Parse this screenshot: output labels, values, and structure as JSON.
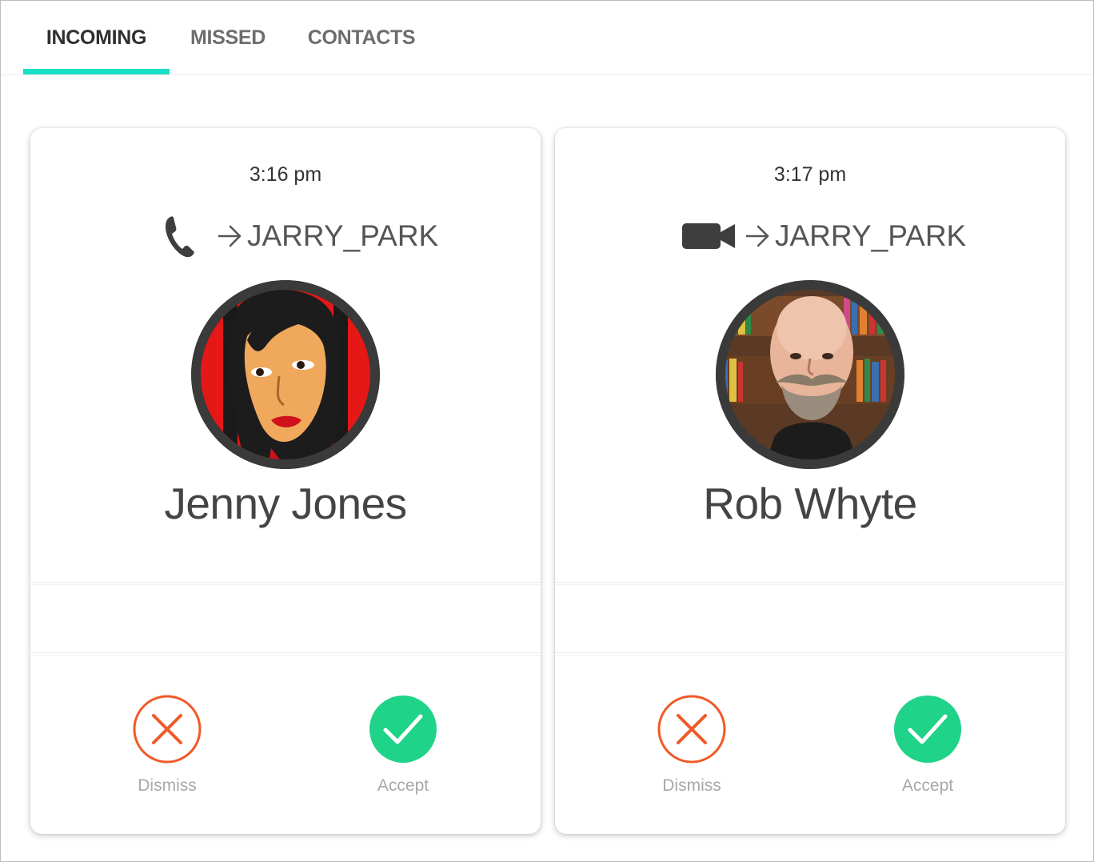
{
  "tabs": [
    {
      "label": "INCOMING",
      "active": true
    },
    {
      "label": "MISSED",
      "active": false
    },
    {
      "label": "CONTACTS",
      "active": false
    }
  ],
  "accent_color": "#19dfc4",
  "calls": [
    {
      "time": "3:16 pm",
      "call_type_icon": "phone-icon",
      "destination": "JARRY_PARK",
      "caller_name": "Jenny Jones",
      "dismiss_label": "Dismiss",
      "accept_label": "Accept"
    },
    {
      "time": "3:17 pm",
      "call_type_icon": "video-camera-icon",
      "destination": "JARRY_PARK",
      "caller_name": "Rob Whyte",
      "dismiss_label": "Dismiss",
      "accept_label": "Accept"
    }
  ],
  "colors": {
    "dismiss": "#f05a28",
    "accept": "#1fd388"
  }
}
